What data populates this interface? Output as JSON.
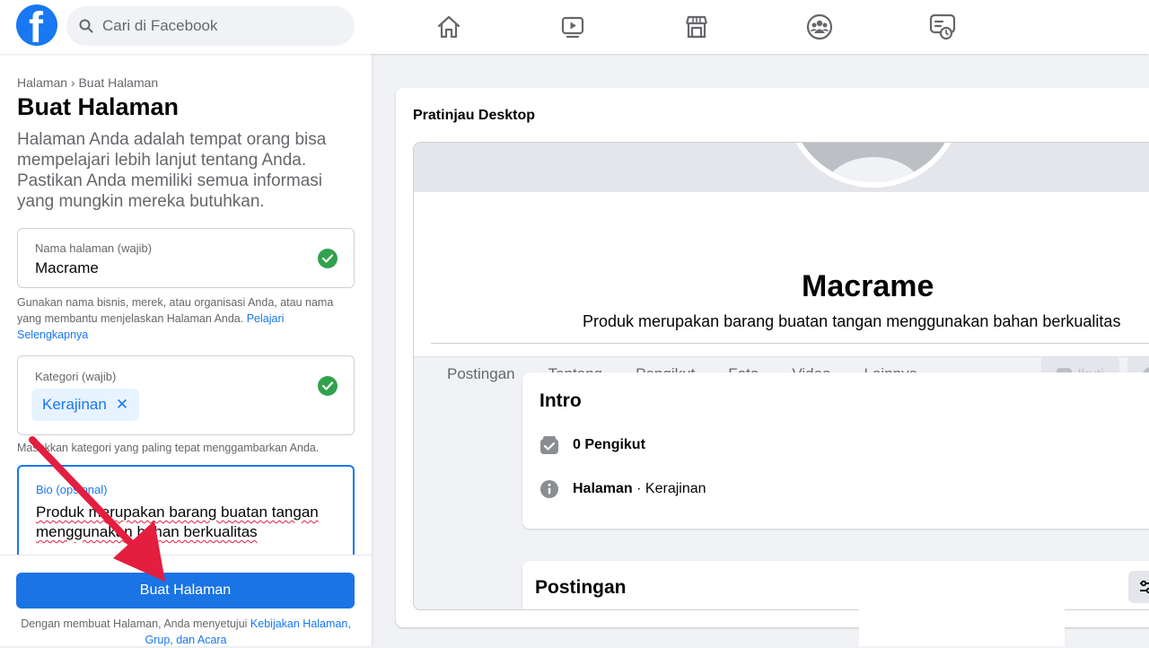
{
  "topbar": {
    "logo_letter": "f",
    "search_placeholder": "Cari di Facebook",
    "nav_icons": [
      "home-icon",
      "video-icon",
      "marketplace-icon",
      "groups-icon",
      "gaming-icon"
    ]
  },
  "form": {
    "breadcrumb": "Halaman › Buat Halaman",
    "title": "Buat Halaman",
    "intro": "Halaman Anda adalah tempat orang bisa mempelajari lebih lanjut tentang Anda. Pastikan Anda memiliki semua informasi yang mungkin mereka butuhkan.",
    "name_field": {
      "label": "Nama halaman (wajib)",
      "value": "Macrame",
      "helper": "Gunakan nama bisnis, merek, atau organisasi Anda, atau nama yang membantu menjelaskan Halaman Anda. ",
      "helper_link": "Pelajari Selengkapnya"
    },
    "category_field": {
      "label": "Kategori (wajib)",
      "chip": "Kerajinan",
      "chip_remove": "✕",
      "helper": "Masukkan kategori yang paling tepat menggambarkan Anda."
    },
    "bio_field": {
      "label": "Bio (opsional)",
      "value": "Produk merupakan barang buatan tangan menggunakan bahan berkualitas"
    },
    "submit_label": "Buat Halaman",
    "terms_prefix": "Dengan membuat Halaman, Anda menyetujui ",
    "terms_link": "Kebijakan Halaman, Grup, dan Acara"
  },
  "preview": {
    "title": "Pratinjau Desktop",
    "page_name": "Macrame",
    "page_bio": "Produk merupakan barang buatan tangan menggunakan bahan berkualitas",
    "tabs": [
      "Postingan",
      "Tentang",
      "Pengikut",
      "Foto",
      "Video",
      "Lainnya"
    ],
    "tab_caret": "▾",
    "follow_label": "Ikuti",
    "intro_heading": "Intro",
    "followers": "0 Pengikut",
    "category_prefix": "Halaman",
    "category_separator": " · ",
    "category_value": "Kerajinan",
    "posts_heading": "Postingan"
  },
  "colors": {
    "brand": "#1877f2",
    "success": "#31a24c",
    "annotation_arrow": "#e41e3f"
  }
}
